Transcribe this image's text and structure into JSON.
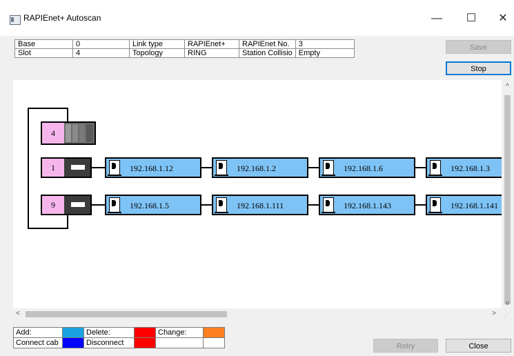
{
  "window": {
    "title": "RAPIEnet+ Autoscan",
    "minimize": "—",
    "maximize": "☐",
    "close": "✕"
  },
  "info": {
    "base_label": "Base",
    "base_value": "0",
    "link_type_label": "Link type",
    "link_type_value": "RAPIEnet+",
    "rapienet_no_label": "RAPIEnet No.",
    "rapienet_no_value": "3",
    "slot_label": "Slot",
    "slot_value": "4",
    "topology_label": "Topology",
    "topology_value": "RING",
    "station_collision_label": "Station Collisio",
    "station_collision_value": "Empty"
  },
  "buttons": {
    "save": "Save",
    "stop": "Stop",
    "retry": "Retry",
    "close": "Close"
  },
  "topology": {
    "top_slot": "4",
    "rows": [
      {
        "slot": "1",
        "nodes": [
          "192.168.1.12",
          "192.168.1.2",
          "192.168.1.6",
          "192.168.1.3"
        ]
      },
      {
        "slot": "9",
        "nodes": [
          "192.168.1.5",
          "192.168.1.111",
          "192.168.1.143",
          "192.168.1.141"
        ]
      }
    ]
  },
  "legend": {
    "add": "Add:",
    "delete": "Delete:",
    "change": "Change:",
    "connect_cable": "Connect cab",
    "disconnect": "Disconnect",
    "colors": {
      "add": "#1ba1e2",
      "delete": "#ff0000",
      "change": "#ff8020",
      "connect_cable": "#0000ff",
      "disconnect": "#ff0000"
    }
  },
  "scroll": {
    "up": "^",
    "down": "v",
    "left": "<",
    "right": ">"
  }
}
